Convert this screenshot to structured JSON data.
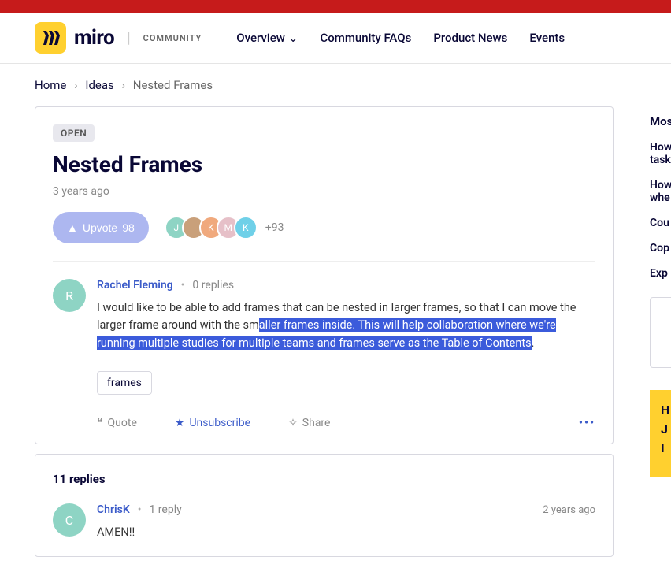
{
  "header": {
    "brand": "miro",
    "community_label": "COMMUNITY",
    "nav": [
      {
        "label": "Overview",
        "hasDropdown": true
      },
      {
        "label": "Community FAQs",
        "hasDropdown": false
      },
      {
        "label": "Product News",
        "hasDropdown": false
      },
      {
        "label": "Events",
        "hasDropdown": false
      }
    ]
  },
  "breadcrumb": {
    "home": "Home",
    "ideas": "Ideas",
    "current": "Nested Frames"
  },
  "post": {
    "status": "OPEN",
    "title": "Nested Frames",
    "timestamp": "3 years ago",
    "upvote_label": "Upvote",
    "upvote_count": "98",
    "avatar_initials": [
      "J",
      "",
      "K",
      "M",
      "K"
    ],
    "more_count": "+93",
    "author_initial": "R",
    "author": "Rachel Fleming",
    "reply_count": "0 replies",
    "body_plain": "I would like to be able to add frames that can be nested in larger frames, so that I can move the larger frame around with the sm",
    "body_highlight": "aller frames inside. This will help collaboration where we're running multiple studies for multiple teams and frames serve as the Table of Contents",
    "body_tail": ".",
    "tag": "frames",
    "actions": {
      "quote": "Quote",
      "unsubscribe": "Unsubscribe",
      "share": "Share"
    }
  },
  "replies": {
    "count_label": "11 replies",
    "first": {
      "initial": "C",
      "author": "ChrisK",
      "reply_count": "1 reply",
      "timestamp": "2 years ago",
      "body": "AMEN!!"
    }
  },
  "sidebar": {
    "title": "Mos",
    "items": [
      "How\ntask",
      "How\nwhe",
      "Cou",
      "Cop",
      "Exp"
    ],
    "yellow": "H\nJ\nI"
  }
}
